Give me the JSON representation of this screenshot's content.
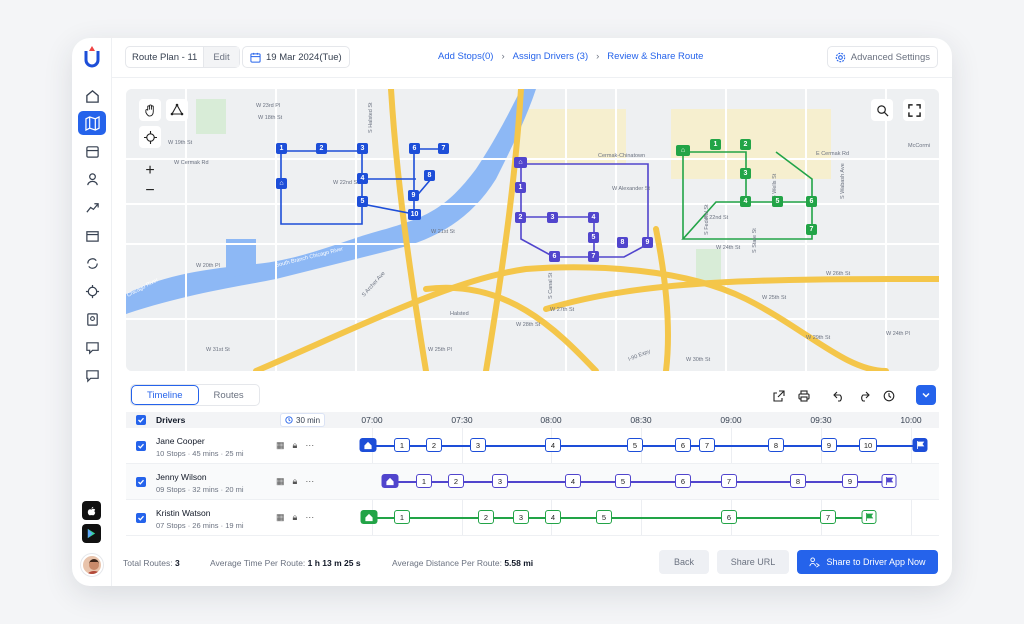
{
  "header": {
    "route_plan": "Route Plan - 11",
    "edit": "Edit",
    "date": "19 Mar 2024(Tue)",
    "steps": [
      "Add Stops(0)",
      "Assign Drivers (3)",
      "Review & Share Route"
    ],
    "advanced_settings": "Advanced Settings"
  },
  "map": {
    "labels": [
      "W Cermak Rd",
      "Cermak-Chinatown",
      "E Cermak Rd",
      "McCormi",
      "South Branch Chicago River",
      "Chicago River",
      "S Archer Ave",
      "W 24th St",
      "W 26th St",
      "W 28th St",
      "W 31st St",
      "Halsted",
      "I-90 Expy",
      "W Alexander St",
      "W 22nd St",
      "W 23rd Pl",
      "W 25th Pl",
      "W 18th St",
      "W 19th St",
      "W 20th Pl",
      "W 21st St",
      "E 22nd St",
      "W 24th Pl",
      "W 25th St",
      "W 29th St",
      "W 30th St",
      "W 27th St",
      "S Canal St",
      "S Wells St",
      "S Wabash Ave",
      "S Halsted St",
      "S State St",
      "S Federal St"
    ],
    "blue_pins": [
      "1",
      "2",
      "3",
      "4",
      "5",
      "6",
      "7",
      "8",
      "9",
      "10"
    ],
    "purple_pins": [
      "1",
      "2",
      "3",
      "4",
      "5",
      "6",
      "7",
      "8",
      "9"
    ],
    "green_pins": [
      "1",
      "2",
      "3",
      "4",
      "5",
      "6",
      "7"
    ]
  },
  "toolbar": {
    "tabs": [
      "Timeline",
      "Routes"
    ]
  },
  "timeline": {
    "drivers_label": "Drivers",
    "interval": "30 min",
    "times": [
      "07:00",
      "07:30",
      "08:00",
      "08:30",
      "09:00",
      "09:30",
      "10:00"
    ],
    "drivers": [
      {
        "name": "Jane Cooper",
        "meta": "10 Stops  ·  45 mins  ·  25 mi",
        "color": "#1d4ed8",
        "stops": [
          "1",
          "2",
          "3",
          "4",
          "5",
          "6",
          "7",
          "8",
          "9",
          "10"
        ]
      },
      {
        "name": "Jenny Wilson",
        "meta": "09 Stops  ·  32 mins  ·  20 mi",
        "color": "#5145cd",
        "stops": [
          "1",
          "2",
          "3",
          "4",
          "5",
          "6",
          "7",
          "8",
          "9"
        ]
      },
      {
        "name": "Kristin Watson",
        "meta": "07 Stops  ·  26 mins  ·  19 mi",
        "color": "#22a447",
        "stops": [
          "1",
          "2",
          "3",
          "4",
          "5",
          "6",
          "7"
        ]
      }
    ]
  },
  "footer": {
    "total_routes_label": "Total Routes:",
    "total_routes": "3",
    "avg_time_label": "Average Time Per Route:",
    "avg_time": "1 h 13 m 25 s",
    "avg_dist_label": "Average Distance Per Route:",
    "avg_dist": "5.58 mi",
    "back": "Back",
    "share_url": "Share URL",
    "share_driver": "Share to Driver App Now"
  }
}
